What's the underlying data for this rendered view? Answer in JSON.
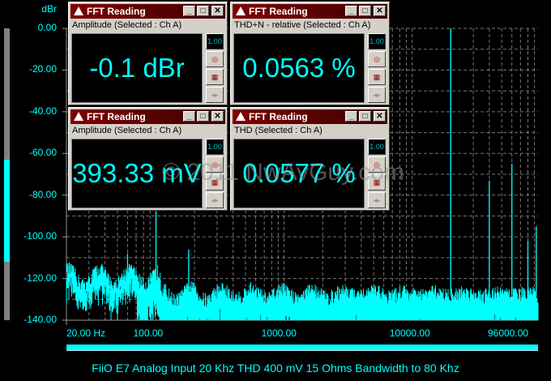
{
  "chart_data": {
    "type": "line",
    "title": "FiiO E7 Analog Input 20 Khz THD 400 mV 15 Ohms Bandwidth to 80 Khz",
    "ylabel": "dBr",
    "xlabel": "Hz",
    "ylim": [
      -140,
      0
    ],
    "xlim": [
      20,
      96000
    ],
    "xscale": "log",
    "y_ticks": [
      "0.00",
      "-20.00",
      "-40.00",
      "-60.00",
      "-80.00",
      "-100.00",
      "-120.00",
      "-140.00"
    ],
    "x_ticks": [
      {
        "v": 20,
        "label": "20.00 Hz"
      },
      {
        "v": 100,
        "label": "100.00"
      },
      {
        "v": 1000,
        "label": "1000.00"
      },
      {
        "v": 10000,
        "label": "10000.00"
      },
      {
        "v": 96000,
        "label": "96000.00"
      }
    ],
    "grid": true,
    "noise_floor_db": -128,
    "peaks": [
      {
        "f": 20000,
        "db": 0
      },
      {
        "f": 40000,
        "db": -73
      },
      {
        "f": 60000,
        "db": -65
      },
      {
        "f": 80000,
        "db": -102
      },
      {
        "f": 93000,
        "db": -95
      },
      {
        "f": 100,
        "db": -88
      },
      {
        "f": 60,
        "db": -108
      },
      {
        "f": 180,
        "db": -106
      }
    ],
    "level_meter": {
      "low_db": -112,
      "high_db": -63
    }
  },
  "windows": [
    {
      "title": "FFT Reading",
      "subtitle": "Amplitude (Selected : Ch A)",
      "value": "-0.1 dBr"
    },
    {
      "title": "FFT Reading",
      "subtitle": "THD+N - relative (Selected : Ch A)",
      "value": "0.0563 %"
    },
    {
      "title": "FFT Reading",
      "subtitle": "Amplitude (Selected : Ch A)",
      "value": "393.33 mV"
    },
    {
      "title": "FFT Reading",
      "subtitle": "THD (Selected : Ch A)",
      "value": "0.0577 %"
    }
  ],
  "watermark": "© 2011 NwAvGuy.com",
  "units_btn": "1.00"
}
